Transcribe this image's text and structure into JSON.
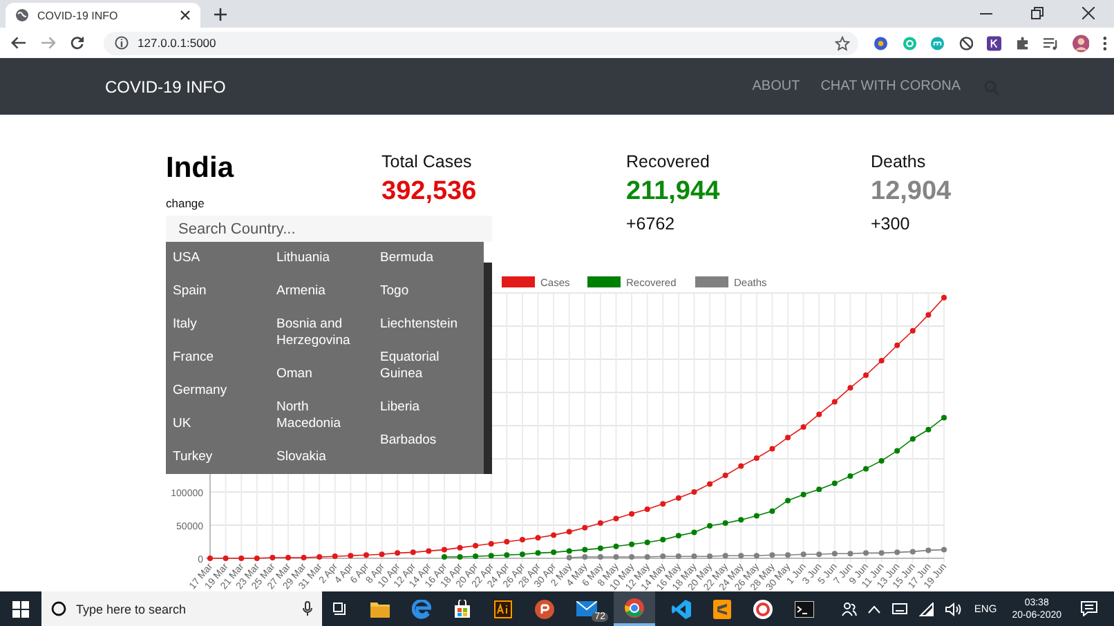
{
  "browser": {
    "tab": {
      "title": "COVID-19 INFO",
      "selected": true
    },
    "url": "127.0.0.1:5000"
  },
  "navbar": {
    "brand": "COVID-19 INFO",
    "links": [
      "ABOUT",
      "CHAT WITH CORONA"
    ]
  },
  "country": {
    "name": "India",
    "change_link": "change"
  },
  "stats": [
    {
      "label": "Total Cases",
      "value": "392,536",
      "color": "#e30b0b"
    },
    {
      "label": "Recovered",
      "value": "211,944",
      "delta": "+6762",
      "color": "#0a8a0a"
    },
    {
      "label": "Deaths",
      "value": "12,904",
      "delta": "+300",
      "color": "#858585"
    }
  ],
  "search": {
    "placeholder": "Search Country..."
  },
  "country_list": {
    "columns": [
      [
        "USA",
        "Spain",
        "Italy",
        "France",
        "Germany",
        "UK",
        "Turkey"
      ],
      [
        "Lithuania",
        "Armenia",
        "Bosnia and Herzegovina",
        "Oman",
        "North Macedonia",
        "Slovakia"
      ],
      [
        "Bermuda",
        "Togo",
        "Liechtenstein",
        "Equatorial Guinea",
        "Liberia",
        "Barbados"
      ]
    ]
  },
  "chart": {
    "chart_data": {
      "type": "line",
      "categories": [
        "17 Mar",
        "19 Mar",
        "21 Mar",
        "23 Mar",
        "25 Mar",
        "27 Mar",
        "29 Mar",
        "31 Mar",
        "2 Apr",
        "4 Apr",
        "6 Apr",
        "8 Apr",
        "10 Apr",
        "12 Apr",
        "14 Apr",
        "16 Apr",
        "18 Apr",
        "20 Apr",
        "22 Apr",
        "24 Apr",
        "26 Apr",
        "28 Apr",
        "30 Apr",
        "2 May",
        "4 May",
        "6 May",
        "8 May",
        "10 May",
        "12 May",
        "14 May",
        "16 May",
        "18 May",
        "20 May",
        "22 May",
        "24 May",
        "26 May",
        "28 May",
        "30 May",
        "1 Jun",
        "3 Jun",
        "5 Jun",
        "7 Jun",
        "9 Jun",
        "11 Jun",
        "13 Jun",
        "15 Jun",
        "17 Jun",
        "19 Jun"
      ],
      "series": [
        {
          "name": "Cases",
          "color": "#e31a1a",
          "marker": "circle",
          "values": [
            0,
            0,
            0,
            0,
            1000,
            1000,
            1000,
            2000,
            3000,
            4000,
            5000,
            6000,
            8000,
            9000,
            11000,
            13000,
            16000,
            19000,
            22000,
            25000,
            28000,
            31000,
            35000,
            40000,
            46000,
            53000,
            60000,
            67000,
            74000,
            82000,
            91000,
            100000,
            112000,
            125000,
            139000,
            151000,
            165000,
            182000,
            198000,
            217000,
            236000,
            257000,
            276000,
            298000,
            321000,
            343000,
            367000,
            393000
          ]
        },
        {
          "name": "Recovered",
          "color": "#008000",
          "marker": "circle",
          "values": [
            null,
            null,
            null,
            null,
            null,
            null,
            null,
            null,
            null,
            null,
            null,
            null,
            null,
            null,
            null,
            2000,
            2000,
            3000,
            4000,
            5000,
            6000,
            8000,
            9000,
            11000,
            13000,
            15000,
            18000,
            21000,
            24000,
            28000,
            34000,
            39000,
            49000,
            53000,
            58000,
            64000,
            71000,
            87000,
            96000,
            104000,
            113000,
            124000,
            135000,
            147000,
            162000,
            180000,
            194000,
            212000
          ]
        },
        {
          "name": "Deaths",
          "color": "#808080",
          "marker": "circle",
          "values": [
            null,
            null,
            null,
            null,
            null,
            null,
            null,
            null,
            null,
            null,
            null,
            null,
            null,
            null,
            null,
            null,
            null,
            null,
            null,
            null,
            null,
            null,
            null,
            1000,
            2000,
            2000,
            2000,
            2000,
            2000,
            3000,
            3000,
            3000,
            3000,
            4000,
            4000,
            4000,
            5000,
            5000,
            6000,
            6000,
            7000,
            7000,
            8000,
            8000,
            9000,
            10000,
            12000,
            13000
          ]
        }
      ],
      "ylim": [
        0,
        400000
      ],
      "yticks": [
        0,
        50000,
        100000
      ],
      "grid": true,
      "legend": true
    }
  },
  "taskbar": {
    "search_placeholder": "Type here to search",
    "mail_badge": "72",
    "language": "ENG",
    "time": "03:38",
    "date": "20-06-2020"
  }
}
